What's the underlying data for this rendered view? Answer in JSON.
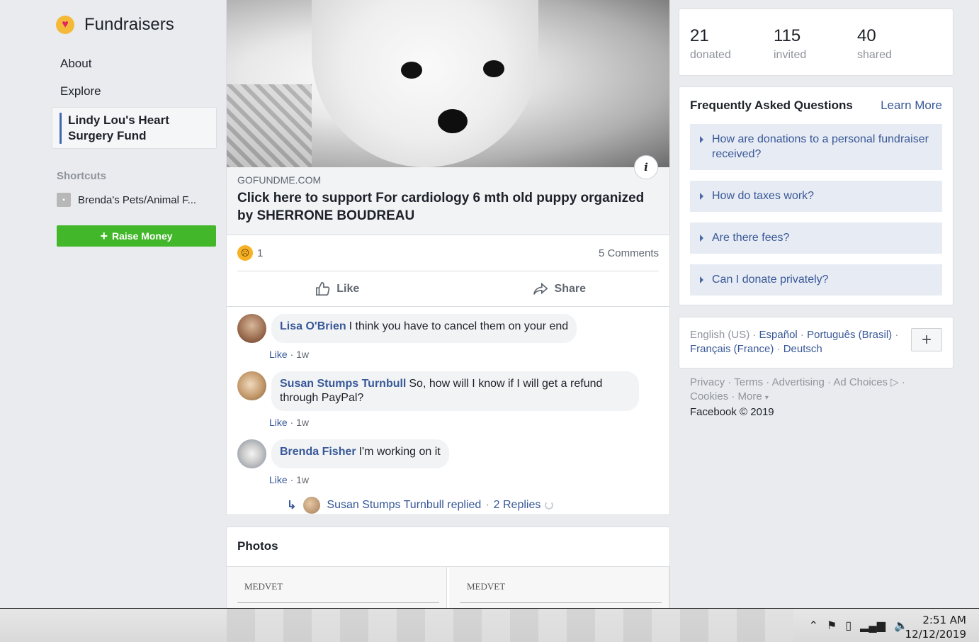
{
  "sidebar": {
    "title": "Fundraisers",
    "nav": [
      "About",
      "Explore"
    ],
    "active_line1": "Lindy Lou's Heart",
    "active_line2": "Surgery Fund",
    "shortcuts_heading": "Shortcuts",
    "shortcut_item": "Brenda's Pets/Animal F...",
    "raise_button": "Raise Money"
  },
  "post": {
    "link_domain": "GOFUNDME.COM",
    "link_title": "Click here to support For cardiology 6 mth old puppy organized by SHERRONE BOUDREAU",
    "reaction_count": "1",
    "comments_count": "5 Comments",
    "like_label": "Like",
    "share_label": "Share",
    "info_glyph": "i"
  },
  "comments": [
    {
      "author": "Lisa O'Brien",
      "text": "I think you have to cancel them on your end",
      "like": "Like",
      "time": "1w"
    },
    {
      "author": "Susan Stumps Turnbull",
      "text": "So, how will I know if I will get a refund through PayPal?",
      "like": "Like",
      "time": "1w"
    },
    {
      "author": "Brenda Fisher",
      "text": "I'm working on it",
      "like": "Like",
      "time": "1w"
    }
  ],
  "reply": {
    "text": "Susan Stumps Turnbull replied",
    "sep": "·",
    "count": "2 Replies"
  },
  "photos": {
    "heading": "Photos",
    "doc_brand": "MEDVET"
  },
  "stats": [
    {
      "num": "21",
      "label": "donated"
    },
    {
      "num": "115",
      "label": "invited"
    },
    {
      "num": "40",
      "label": "shared"
    }
  ],
  "faq": {
    "title": "Frequently Asked Questions",
    "learn_more": "Learn More",
    "items": [
      "How are donations to a personal fundraiser received?",
      "How do taxes work?",
      "Are there fees?",
      "Can I donate privately?"
    ]
  },
  "languages": {
    "current": "English (US)",
    "l1": "Español",
    "l2": "Português (Brasil)",
    "l3": "Français (France)",
    "l4": "Deutsch"
  },
  "footer": {
    "privacy": "Privacy",
    "terms": "Terms",
    "advertising": "Advertising",
    "ad_choices": "Ad Choices",
    "cookies": "Cookies",
    "more": "More",
    "copyright": "Facebook © 2019"
  },
  "taskbar": {
    "time": "2:51 AM",
    "date": "12/12/2019"
  },
  "colors": {
    "link_blue": "#385898",
    "raise_green": "#42b72a",
    "faq_bg": "#e7ebf3",
    "page_bg": "#e9ebee"
  }
}
